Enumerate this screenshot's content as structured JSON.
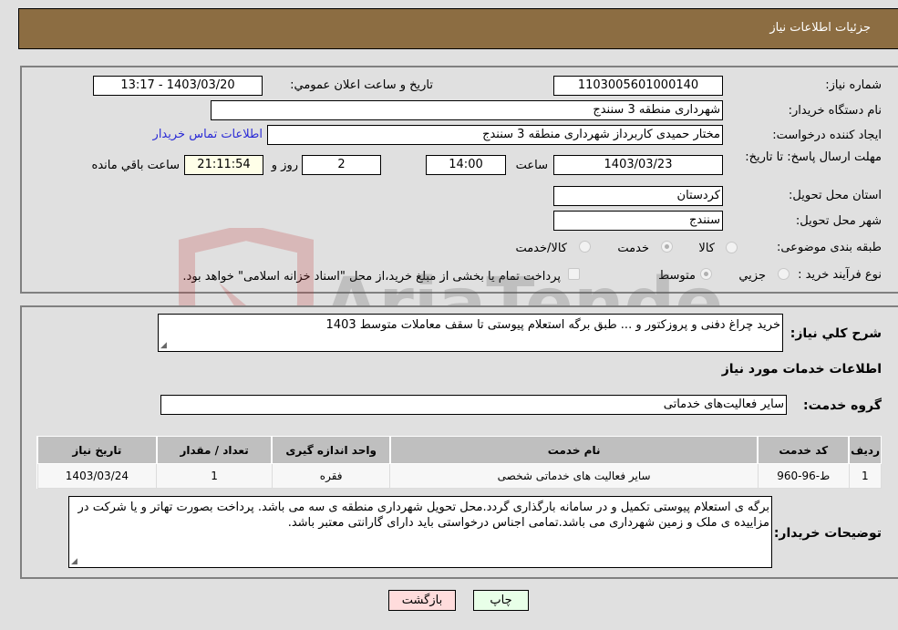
{
  "header": {
    "title": "جزئیات اطلاعات نیاز"
  },
  "fields": {
    "need_number_label": "شماره نیاز:",
    "need_number": "1103005601000140",
    "announce_label": "تاریخ و ساعت اعلان عمومي:",
    "announce_value": "1403/03/20 - 13:17",
    "buyer_org_label": "نام دستگاه خریدار:",
    "buyer_org": "شهرداری منطقه 3 سنندج",
    "creator_label": "ایجاد کننده درخواست:",
    "creator": "مختار حمیدی کاربرداز شهرداری منطقه 3 سنندج",
    "contact_link": "اطلاعات تماس خریدار",
    "deadline_label": "مهلت ارسال پاسخ: تا تاریخ:",
    "deadline_date": "1403/03/23",
    "time_label": "ساعت",
    "deadline_time": "14:00",
    "days_value": "2",
    "days_label": "روز و",
    "remaining_time": "21:11:54",
    "remaining_label": "ساعت باقي مانده",
    "province_label": "استان محل تحویل:",
    "province": "کردستان",
    "city_label": "شهر محل تحویل:",
    "city": "سنندج",
    "category_label": "طبقه بندی موضوعی:",
    "category_options": [
      "کالا",
      "خدمت",
      "کالا/خدمت"
    ],
    "category_selected": "خدمت",
    "process_label": "نوع فرآیند خرید :",
    "process_options": [
      "جزيي",
      "متوسط"
    ],
    "process_selected": "متوسط",
    "treasury_note": "پرداخت تمام یا بخشی از مبلغ خرید،از محل \"اسناد خزانه اسلامی\" خواهد بود."
  },
  "description": {
    "label": "شرح کلي نياز:",
    "value": "خرید چراغ دفنی و پروزکتور و ... طبق برگه استعلام پیوستی تا سقف معاملات متوسط 1403"
  },
  "services": {
    "section_title": "اطلاعات خدمات مورد نیاز",
    "group_label": "گروه خدمت:",
    "group_value": "سایر فعالیت‌های خدماتی",
    "columns": [
      "ردیف",
      "کد خدمت",
      "نام خدمت",
      "واحد اندازه گیری",
      "تعداد / مقدار",
      "تاریخ نیاز"
    ],
    "rows": [
      [
        "1",
        "ط-96-960",
        "سایر فعالیت های خدماتی شخصی",
        "فقره",
        "1",
        "1403/03/24"
      ]
    ]
  },
  "buyer_notes": {
    "label": "توضیحات خریدار:",
    "value": "برگه ی استعلام پیوستی تکمیل و در سامانه بارگذاری گردد.محل تحویل شهرداری منطقه ی سه می باشد. پرداخت بصورت تهاتر و یا شرکت در مزاییده ی ملک و زمین شهرداری می باشد.تمامی اجناس درخواستی باید دارای گارانتی معتبر باشد."
  },
  "buttons": {
    "print": "چاپ",
    "back": "بازگشت"
  },
  "watermark": {
    "text": "AriaTender.neT"
  }
}
